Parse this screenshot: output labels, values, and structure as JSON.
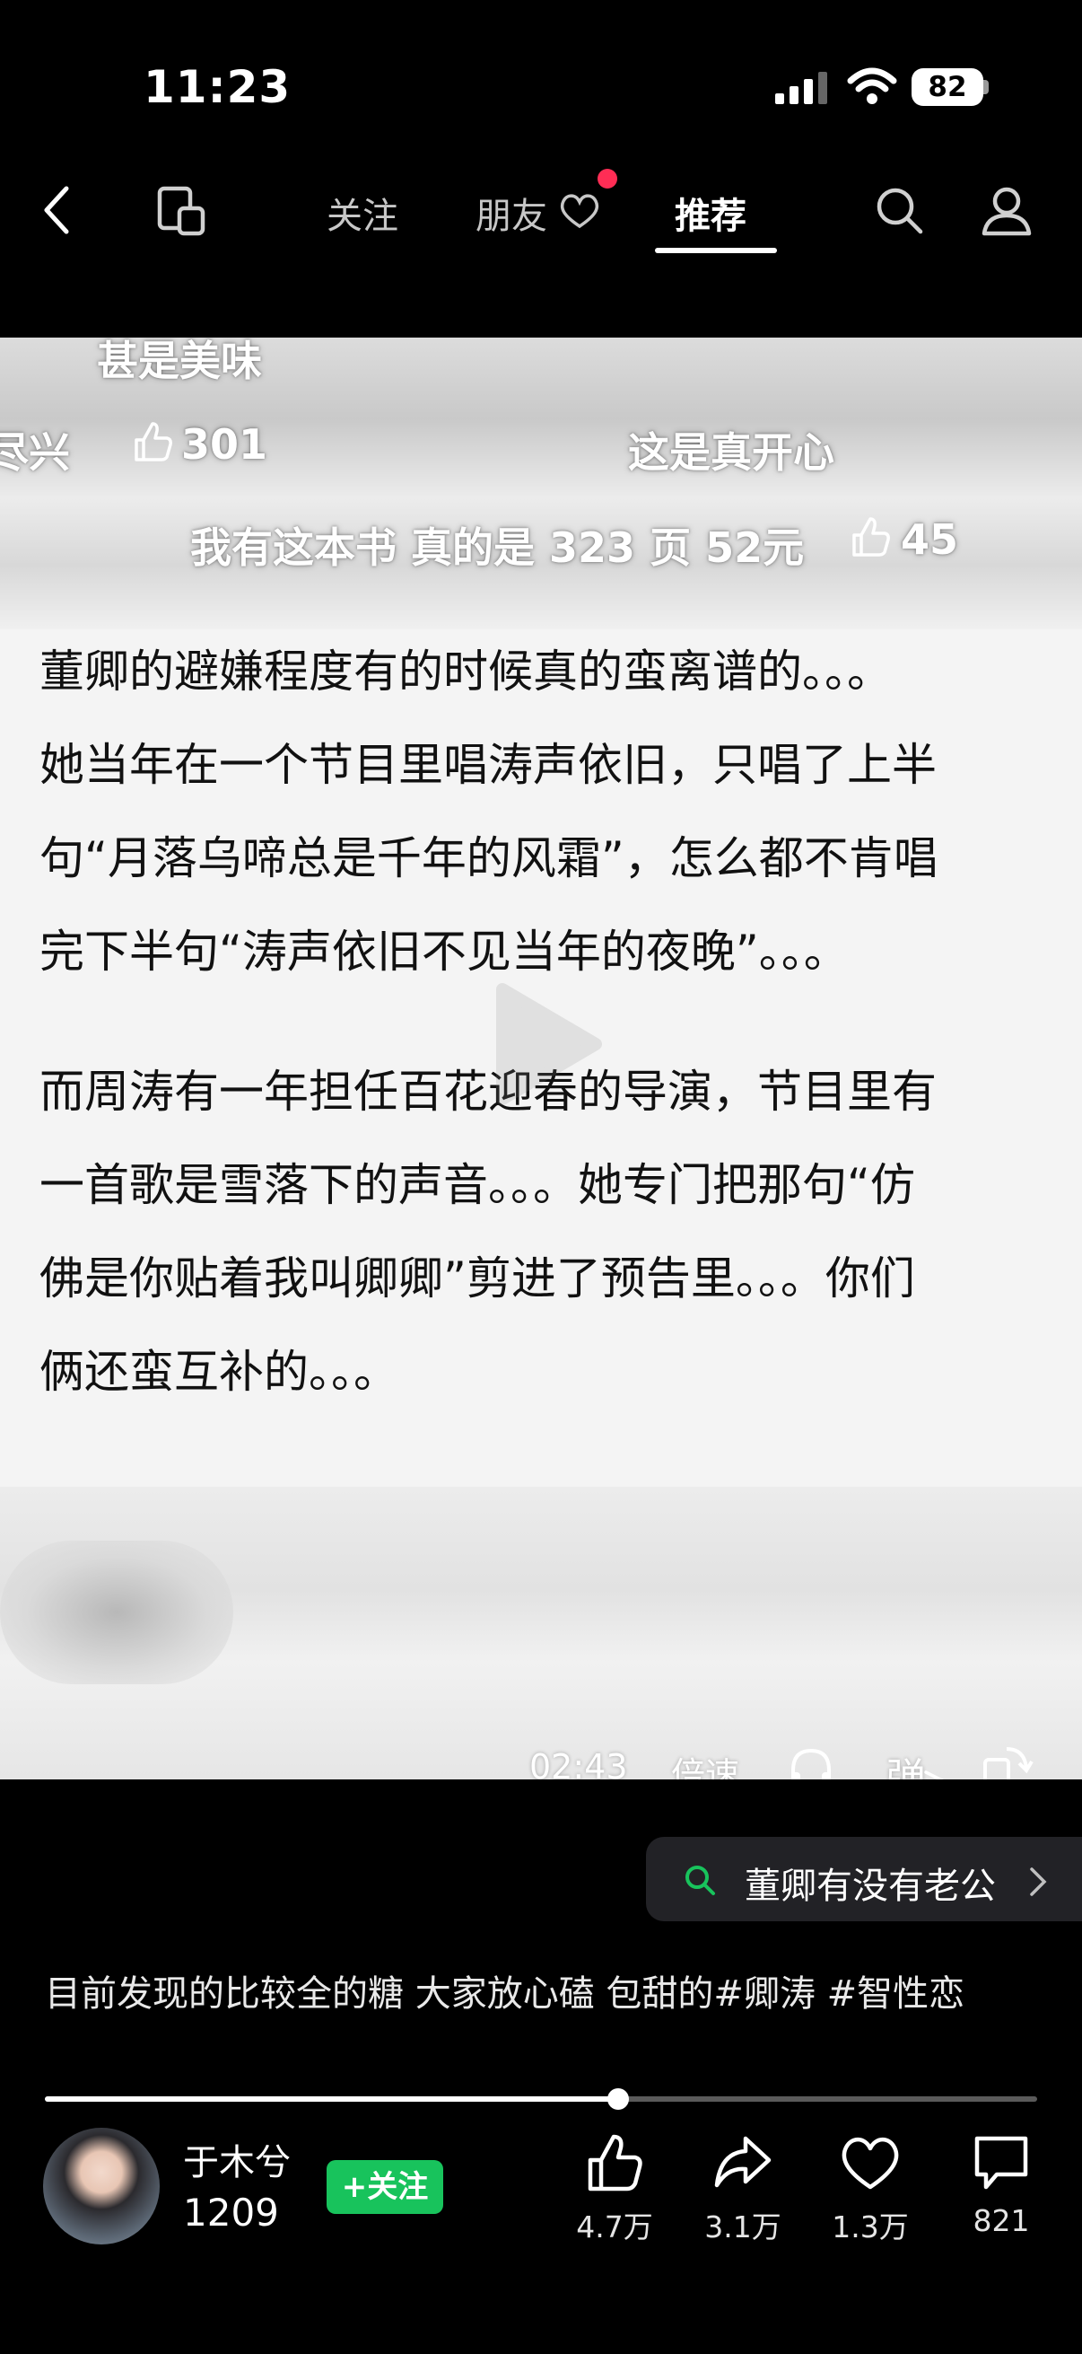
{
  "status_bar": {
    "time": "11:23",
    "battery": "82"
  },
  "nav": {
    "tabs": [
      {
        "label": "关注"
      },
      {
        "label": "朋友"
      },
      {
        "label": "推荐"
      }
    ],
    "active_tab": "推荐"
  },
  "video": {
    "ghost_comments": [
      {
        "text": "甚是美味"
      },
      {
        "text": "尽兴",
        "likes": "301"
      },
      {
        "text": "这是真开心"
      },
      {
        "text": "我有这本书 真的是 323 页 52元",
        "likes": "45"
      }
    ],
    "paragraphs": [
      [
        "董卿的避嫌程度有的时候真的蛮离谱的。。。",
        "她当年在一个节目里唱涛声依旧，只唱了上半",
        "句“月落乌啼总是千年的风霜”，怎么都不肯唱",
        "完下半句“涛声依旧不见当年的夜晚”。。。"
      ],
      [
        "而周涛有一年担任百花迎春的导演，节目里有",
        "一首歌是雪落下的声音。。。她专门把那句“仿",
        "佛是你贴着我叫卿卿”剪进了预告里。。。你们",
        "俩还蛮互补的。。。"
      ]
    ],
    "controls": {
      "time": "02:43",
      "speed": "倍速",
      "danmaku": "弹"
    }
  },
  "search": {
    "query": "董卿有没有老公"
  },
  "caption": "目前发现的比较全的糖 大家放心磕 包甜的#卿涛 #智性恋",
  "progress": {
    "fraction": 0.578
  },
  "author": {
    "name": "于木兮",
    "count": "1209",
    "follow_label": "+关注"
  },
  "actions": {
    "like": "4.7万",
    "share": "3.1万",
    "favorite": "1.3万",
    "comment": "821"
  }
}
